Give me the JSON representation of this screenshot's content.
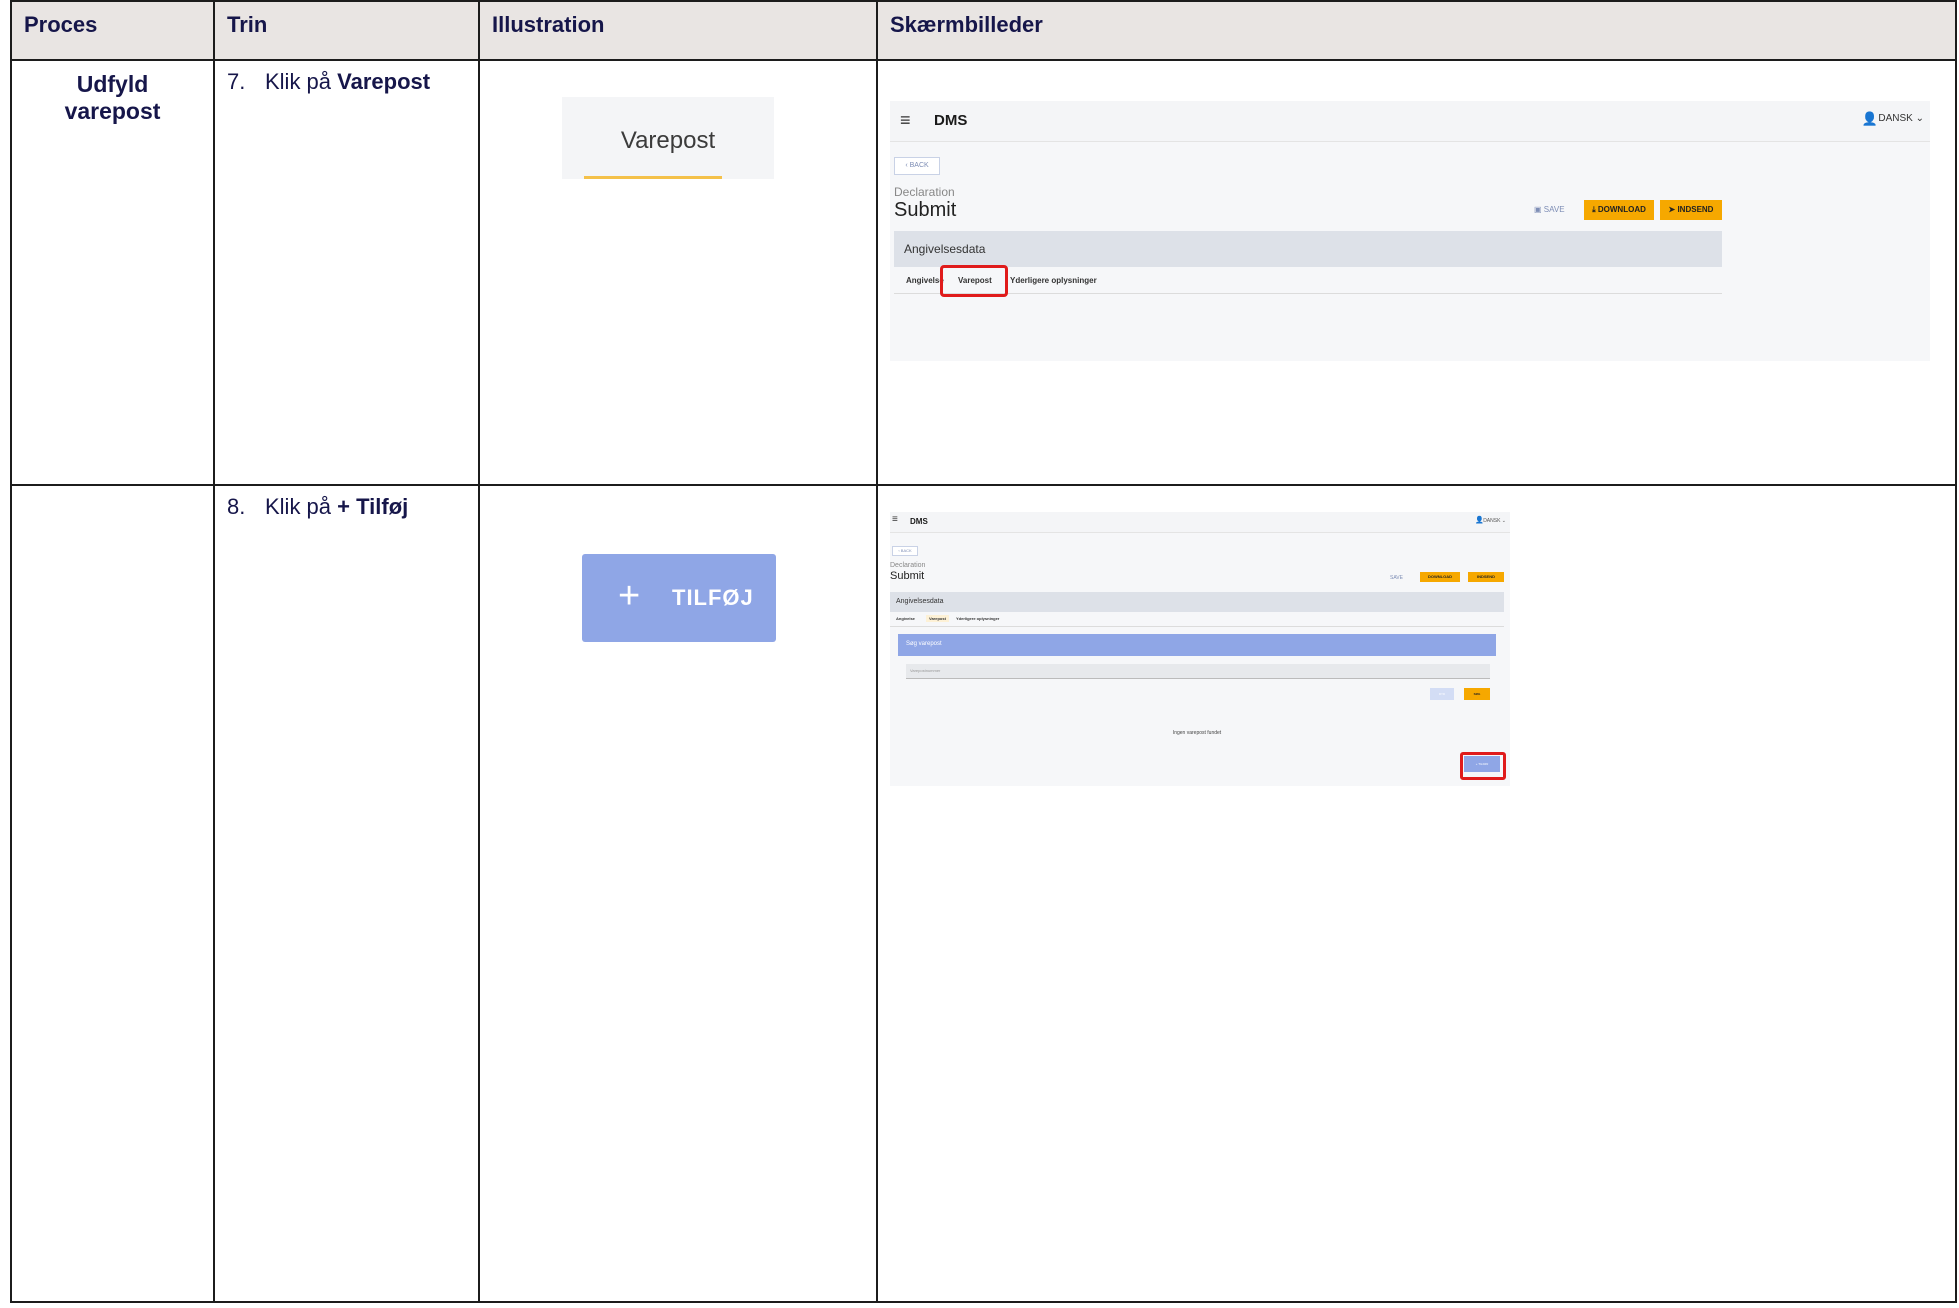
{
  "table": {
    "headers": [
      "Proces",
      "Trin",
      "Illustration",
      "Skærmbilleder"
    ]
  },
  "rows": [
    {
      "process": "Udfyld varepost",
      "step_num": "7.",
      "step_text": "Klik på ",
      "step_bold": "Varepost",
      "illustration_label": "Varepost"
    },
    {
      "process": "",
      "step_num": "8.",
      "step_text": "Klik på ",
      "step_bold": "+ Tilføj",
      "illustration_plus": "+",
      "illustration_label": "TILFØJ"
    }
  ],
  "screen1": {
    "menu": "≡",
    "brand": "DMS",
    "user_icon": "👤",
    "language": "DANSK ⌄",
    "back": "‹ BACK",
    "breadcrumb": "Declaration",
    "title": "Submit",
    "save": "SAVE",
    "download": "DOWNLOAD",
    "send": "INDSEND",
    "panel_title": "Angivelsesdata",
    "tabs": [
      "Angivelse",
      "Varepost",
      "Yderligere oplysninger"
    ]
  },
  "screen2": {
    "menu": "≡",
    "brand": "DMS",
    "user_icon": "👤",
    "language": "DANSK ⌄",
    "back": "‹ BACK",
    "breadcrumb": "Declaration",
    "title": "Submit",
    "save": "SAVE",
    "download": "DOWNLOAD",
    "send": "INDSEND",
    "panel_title": "Angivelsesdata",
    "tabs": [
      "Angivelse",
      "Varepost",
      "Yderligere oplysninger"
    ],
    "search_title": "Søg varepost",
    "search_placeholder": "Varepostnummer",
    "clear": "RYD",
    "search": "SØG",
    "empty_message": "Ingen varepost fundet",
    "add": "+ TILFØJ"
  }
}
